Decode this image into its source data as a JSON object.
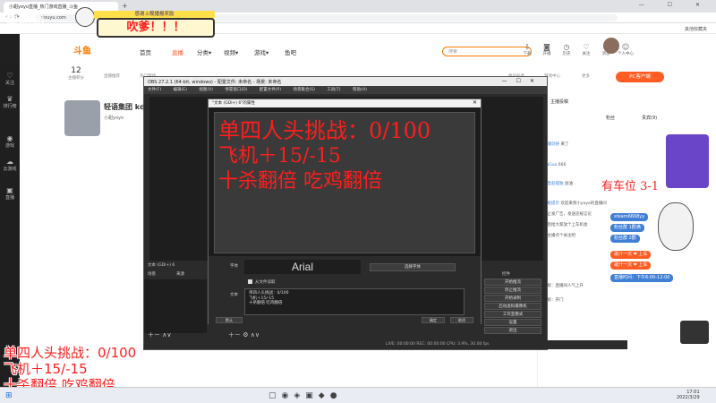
{
  "browser": {
    "tab_title": "小甜yoyo直播_热门游戏直播_斗鱼",
    "new_tab_glyph": "+",
    "window_controls": "— ☐ ✕",
    "url": "douyu.com",
    "bookmark_right": "其他收藏夹"
  },
  "overlay": {
    "top_left_name": "宇甜甜",
    "banner": "感谢上舰播报奖励",
    "callout": "吹爹！！！",
    "car_seats": "有车位 3-1",
    "bottom_lines": [
      "单四人头挑战：0/100",
      "飞机＋15/-15",
      "十杀翻倍 吃鸡翻倍"
    ],
    "tags": [
      {
        "text": "steam6668yy",
        "color": "#3f7fd6"
      },
      {
        "text": "粉丝群 1群满",
        "color": "#3f7fd6"
      },
      {
        "text": "粉丝群 2群",
        "color": "#3f7fd6"
      },
      {
        "text": "歌汁一次 ❤ 上车",
        "color": "#ff5d23"
      },
      {
        "text": "歌汁一次 ❤ 上车",
        "color": "#ff5d23"
      },
      {
        "text": "直播时间：下午6:00-12:00",
        "color": "#3f7fd6"
      }
    ]
  },
  "site": {
    "logo": "斗鱼",
    "nav": [
      "首页",
      "直播",
      "分类▾",
      "视频▾",
      "游戏▾",
      "鱼吧"
    ],
    "active_nav": "直播",
    "search_placeholder": "搜索",
    "header_icons": [
      {
        "label": "下载",
        "icon": "download-icon"
      },
      {
        "label": "开播",
        "icon": "camera-icon"
      },
      {
        "label": "历史",
        "icon": "history-icon"
      },
      {
        "label": "关注",
        "icon": "heart-icon"
      },
      {
        "label": "消息",
        "icon": "bell-icon"
      },
      {
        "label": "个人中心",
        "icon": "user-icon"
      }
    ],
    "left_nav": [
      {
        "label": "关注",
        "icon": "heart-icon"
      },
      {
        "label": "排行榜",
        "icon": "trophy-icon"
      },
      {
        "label": "游戏",
        "icon": "gamepad-icon"
      },
      {
        "label": "云游戏",
        "icon": "cloud-icon"
      },
      {
        "label": "直播",
        "icon": "tv-icon"
      }
    ],
    "stats": [
      {
        "num": "12",
        "label": "主播积分"
      },
      {
        "num": "",
        "label": "直播推荐"
      },
      {
        "num": "",
        "label": "热门游戏"
      },
      {
        "num": "",
        "label": "每日任务"
      },
      {
        "num": "",
        "label": "游戏中心"
      },
      {
        "num": "",
        "label": "更多"
      }
    ],
    "pc_button": "PC客户端",
    "stream_title": "轻语集团 kd6",
    "streamer": "小甜yoyo"
  },
  "chat": {
    "tabs": [
      "主播投稿",
      "粉丝",
      "贵宾(9)"
    ],
    "lines": [
      {
        "user": "影魂剑侠",
        "text": "来了"
      },
      {
        "user": "DaGua",
        "text": "666"
      },
      {
        "user": "欧皇赵孤独",
        "text": "加油"
      },
      {
        "user": "系统提示",
        "text": "欢迎来到小yoyo的直播间"
      },
      {
        "user": "",
        "text": "禁止发广告，发送违规言论"
      },
      {
        "user": "",
        "text": "最后给大家放个上车机会"
      },
      {
        "user": "",
        "text": "给主播点个关注吧"
      },
      {
        "user": "",
        "text": "系统：直播间人气上升"
      },
      {
        "user": "",
        "text": "系统：开门"
      }
    ]
  },
  "obs": {
    "title": "OBS 27.2.1 (64-bit, windows) - 配置文件: 未命名 - 场景: 未命名",
    "menu": [
      "文件(F)",
      "编辑(E)",
      "视图(V)",
      "停靠窗口(D)",
      "配置文件(P)",
      "场景集合(S)",
      "工具(T)",
      "帮助(H)"
    ],
    "dock_scenes": "场景",
    "dock_sources": "来源",
    "dock_controls": "控件",
    "text_source_label": "文本 (GDI+) 6",
    "controls": [
      "开始推流",
      "停止推流",
      "开始录制",
      "启动虚拟摄像机",
      "工作室模式",
      "设置",
      "退出"
    ],
    "status": "LIVE: 00:00:00  REC: 00:00:00  CPU: 3.9%, 30.00 fps"
  },
  "dialog": {
    "title": "\"文本 (GDI+) 6\"的属性",
    "preview_lines": [
      "单四人头挑战：0/100",
      "飞机＋15/-15",
      "十杀翻倍 吃鸡翻倍"
    ],
    "font_label": "字体",
    "font_name": "Arial",
    "choose_font": "选择字体",
    "from_file": "从文件读取",
    "text_label": "文本",
    "text_lines": [
      "单四人头挑战：0/100",
      "飞机＋15/-15",
      "十杀翻倍 吃鸡翻倍"
    ],
    "buttons": {
      "defaults": "默认",
      "ok": "确定",
      "cancel": "取消"
    }
  },
  "taskbar": {
    "time": "17:01",
    "date": "2022/3/29"
  },
  "colors": {
    "accent": "#ff5d23",
    "overlay_red": "#ff1e1e",
    "obs_bg": "#2b2b2b"
  }
}
